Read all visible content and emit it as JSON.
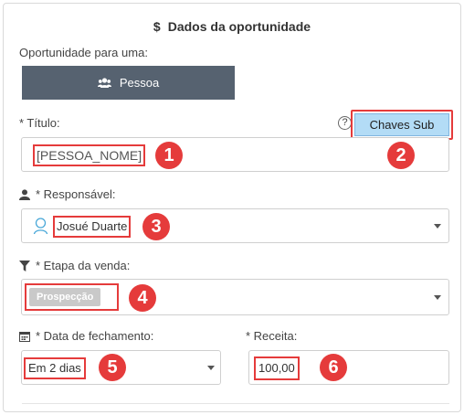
{
  "section": {
    "title": "Dados da oportunidade",
    "icon": "dollar-icon"
  },
  "opportunity_for": {
    "label": "Oportunidade para uma:",
    "option": "Pessoa"
  },
  "title_field": {
    "label": "* Título:",
    "value": "[PESSOA_NOME]"
  },
  "keys_button": {
    "label": "Chaves Sub"
  },
  "responsible": {
    "label": "* Responsável:",
    "value": "Josué Duarte"
  },
  "stage": {
    "label": "* Etapa da venda:",
    "value": "Prospecção"
  },
  "close_date": {
    "label": "* Data de fechamento:",
    "value": "Em 2 dias"
  },
  "revenue": {
    "label": "* Receita:",
    "value": "100,00"
  },
  "markers": [
    "1",
    "2",
    "3",
    "4",
    "5",
    "6"
  ],
  "colors": {
    "marker": "#e53b3b",
    "segment_bg": "#566270",
    "keys_bg": "#b3dcf6"
  }
}
